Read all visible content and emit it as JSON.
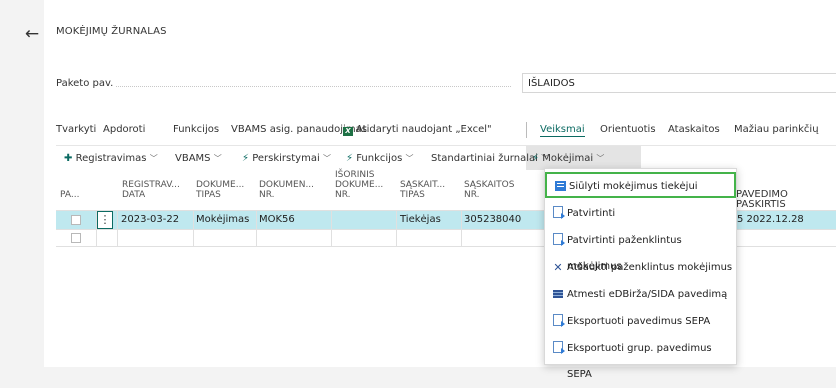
{
  "nav": {
    "back_icon": "←"
  },
  "page": {
    "title": "MOKĖJIMŲ ŽURNALAS"
  },
  "field": {
    "label": "Paketo pav.",
    "value": "IŠLAIDOS"
  },
  "actions": {
    "items": [
      "Tvarkyti",
      "Apdoroti",
      "Funkcijos",
      "VBAMS asig. panaudojimas",
      "Atidaryti naudojant „Excel\"",
      "Veiksmai",
      "Orientuotis",
      "Ataskaitos",
      "Mažiau parinkčių"
    ],
    "excel_icon": "X",
    "active": "Veiksmai"
  },
  "tabs": {
    "items": [
      "Registravimas",
      "VBAMS",
      "Perskirstymai",
      "Funkcijos",
      "Standartiniai žurnalai",
      "Mokėjimai"
    ],
    "registravimas_icon": "✚",
    "bolt_icon": "⚡",
    "chevron": "﹀"
  },
  "grid": {
    "columns": [
      "PA...",
      "REGISTRAV... DATA",
      "DOKUME... TIPAS",
      "DOKUMEN... NR.",
      "IŠORINIS DOKUME... NR.",
      "SĄSKAIT... TIPAS",
      "SĄSKAITOS NR.",
      "PAVEDIMO PASKIRTIS"
    ],
    "col_lines": {
      "c1": [
        "REGISTRAV...",
        "DATA"
      ],
      "c2": [
        "DOKUME...",
        "TIPAS"
      ],
      "c3": [
        "DOKUMEN...",
        "NR."
      ],
      "c4": [
        "IŠORINIS",
        "DOKUME...",
        "NR."
      ],
      "c5": [
        "SĄSKAIT...",
        "TIPAS"
      ],
      "c6": [
        "SĄSKAITOS",
        "NR."
      ],
      "c7": "PAVEDIMO PASKIRTIS",
      "c0": "PA..."
    },
    "rows": [
      {
        "date": "2023-03-22",
        "doc_type": "Mokėjimas",
        "doc_no": "MOK56",
        "ext_doc_no": "",
        "acc_type": "Tiekėjas",
        "acc_no": "305238040",
        "purpose": "5 2022.12.28"
      },
      {
        "date": "",
        "doc_type": "",
        "doc_no": "",
        "ext_doc_no": "",
        "acc_type": "",
        "acc_no": "",
        "purpose": ""
      }
    ],
    "kebab": "⋮"
  },
  "menu": {
    "items": [
      {
        "label": "Siūlyti mokėjimus tiekėjui",
        "icon": "suggest-icon"
      },
      {
        "label": "Patvirtinti",
        "icon": "document-arrow-icon"
      },
      {
        "label": "Patvirtinti paženklintus mokėjimus",
        "icon": "document-arrow-icon"
      },
      {
        "label": "Atšaukti paženklintus mokėjimus",
        "icon": "x-icon"
      },
      {
        "label": "Atmesti eDBirža/SIDA pavedimą",
        "icon": "table-icon"
      },
      {
        "label": "Eksportuoti pavedimus SEPA",
        "icon": "document-arrow-icon"
      },
      {
        "label": "Eksportuoti grup. pavedimus SEPA",
        "icon": "document-arrow-icon"
      }
    ],
    "x_glyph": "✕",
    "highlight_color": "#44b34a"
  },
  "colors": {
    "accent": "#0b6a62",
    "selected_row": "#bfe8ef"
  }
}
